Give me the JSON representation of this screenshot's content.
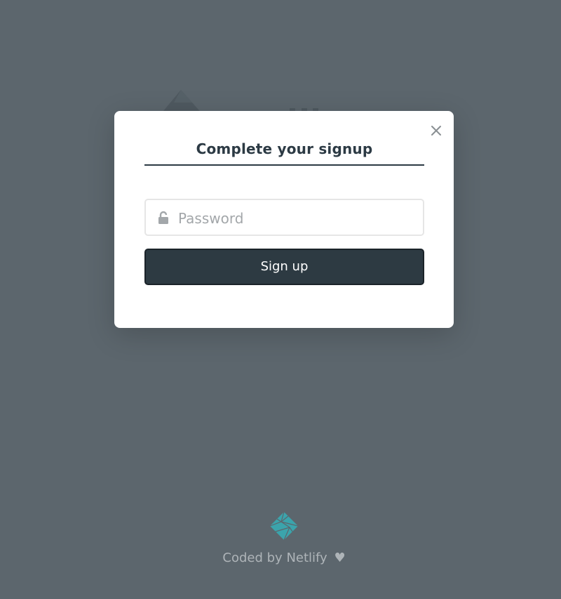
{
  "modal": {
    "title": "Complete your signup",
    "close_icon": "close-icon",
    "password": {
      "placeholder": "Password",
      "value": "",
      "icon": "lock-icon"
    },
    "submit_label": "Sign up"
  },
  "footer": {
    "prefix": "Coded by",
    "link_text": "Netlify",
    "heart": "♥",
    "logo_icon": "netlify-logo-icon"
  },
  "colors": {
    "background": "#5c666d",
    "button": "#2d3a42",
    "netlify_teal": "#3ba4ac"
  }
}
